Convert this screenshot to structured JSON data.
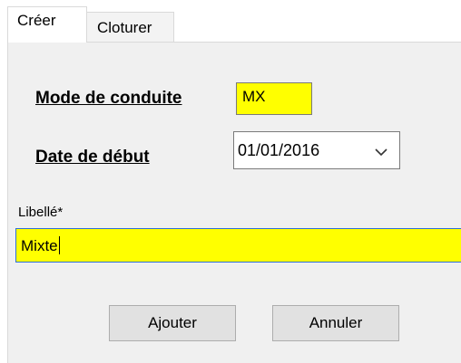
{
  "tabs": [
    {
      "label": "Créer",
      "active": true
    },
    {
      "label": "Cloturer",
      "active": false
    }
  ],
  "form": {
    "mode_label": "Mode de conduite",
    "mode_value": "MX",
    "date_label": "Date de début",
    "date_value": "01/01/2016",
    "libelle_label": "Libellé*",
    "libelle_value": "Mixte"
  },
  "buttons": {
    "add_label": "Ajouter",
    "cancel_label": "Annuler"
  },
  "colors": {
    "field_highlight": "#ffff00",
    "panel_bg": "#f0f0f0",
    "focus_border": "#2f6fd6"
  },
  "icons": {
    "date_dropdown": "chevron-down-icon"
  }
}
